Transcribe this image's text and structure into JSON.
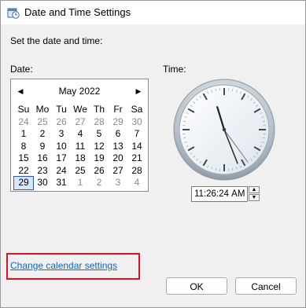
{
  "window": {
    "title": "Date and Time Settings",
    "icon": "date-time-icon"
  },
  "instruction": "Set the date and time:",
  "date_label": "Date:",
  "time_label": "Time:",
  "calendar": {
    "month_title": "May 2022",
    "prev_glyph": "◀",
    "next_glyph": "▶",
    "weekdays": [
      "Su",
      "Mo",
      "Tu",
      "We",
      "Th",
      "Fr",
      "Sa"
    ],
    "weeks": [
      [
        [
          "24",
          1
        ],
        [
          "25",
          1
        ],
        [
          "26",
          1
        ],
        [
          "27",
          1
        ],
        [
          "28",
          1
        ],
        [
          "29",
          1
        ],
        [
          "30",
          1
        ]
      ],
      [
        [
          "1",
          0
        ],
        [
          "2",
          0
        ],
        [
          "3",
          0
        ],
        [
          "4",
          0
        ],
        [
          "5",
          0
        ],
        [
          "6",
          0
        ],
        [
          "7",
          0
        ]
      ],
      [
        [
          "8",
          0
        ],
        [
          "9",
          0
        ],
        [
          "10",
          0
        ],
        [
          "11",
          0
        ],
        [
          "12",
          0
        ],
        [
          "13",
          0
        ],
        [
          "14",
          0
        ]
      ],
      [
        [
          "15",
          0
        ],
        [
          "16",
          0
        ],
        [
          "17",
          0
        ],
        [
          "18",
          0
        ],
        [
          "19",
          0
        ],
        [
          "20",
          0
        ],
        [
          "21",
          0
        ]
      ],
      [
        [
          "22",
          0
        ],
        [
          "23",
          0
        ],
        [
          "24",
          0
        ],
        [
          "25",
          0
        ],
        [
          "26",
          0
        ],
        [
          "27",
          0
        ],
        [
          "28",
          0
        ]
      ],
      [
        [
          "29",
          2
        ],
        [
          "30",
          0
        ],
        [
          "31",
          0
        ],
        [
          "1",
          1
        ],
        [
          "2",
          1
        ],
        [
          "3",
          1
        ],
        [
          "4",
          1
        ]
      ]
    ]
  },
  "time": {
    "hours": "11",
    "minutes": "26",
    "seconds": "24",
    "ampm": "AM",
    "sep": ":"
  },
  "clock": {
    "hour": 11,
    "minute": 26,
    "second": 24
  },
  "link": {
    "label": "Change calendar settings"
  },
  "buttons": {
    "ok": "OK",
    "cancel": "Cancel"
  },
  "colors": {
    "link": "#0a6acb",
    "highlight": "#e01020",
    "selected_day": "#2a5ab8"
  }
}
